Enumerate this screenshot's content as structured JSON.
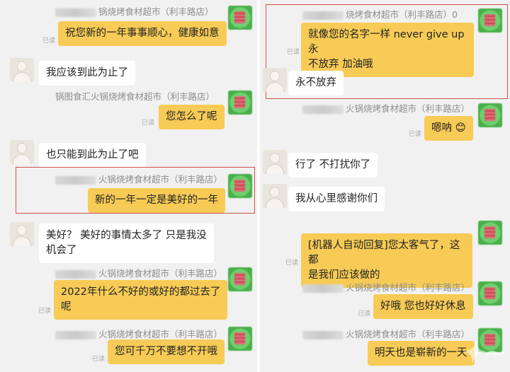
{
  "store_name_partial": {
    "l_n1": "锅烧烤食材超市（利丰路店）",
    "l_n2": "锅图食汇火锅烧烤食材超市（利丰路店）",
    "l_n3": "火锅烧烤食材超市（利丰路店）",
    "l_n4": "火锅烧烤食材超市（利丰路店）",
    "l_n5": "火锅烧烤食材超市（利丰路店）",
    "r_n1": "烧烤食材超市（利丰路店）0",
    "r_n2": "火锅烧烤食材超市（利丰路店）",
    "r_n3": "火锅烧烤食材超市（利丰路店）",
    "r_n4": "火锅烧烤食材超市（利丰路店）",
    "r_n5": "火锅烧烤食材超市（利丰路店）"
  },
  "read_label": "已读",
  "left": {
    "m1": "祝您新的一年事事顺心，健康如意",
    "m2": "我应该到此为止了",
    "m3": "您怎么了呢",
    "m4": "也只能到此为止了吧",
    "m5": "新的一年一定是美好的一年",
    "m6_l1": "美好？ 美好的事情太多了 只是我没",
    "m6_l2": "机会了",
    "m7_l1": "2022年什么不好的或好的都过去了",
    "m7_l2": "呢",
    "m8": "您可千万不要想不开哦"
  },
  "right": {
    "m1_l1": "就像您的名字一样 never give up 永",
    "m1_l2": "不放弃  加油哦",
    "m2": "永不放弃",
    "m3": "嗯呐 😊",
    "m4": "行了 不打扰你了",
    "m5": "我从心里感谢你们",
    "m6_l1": "[机器人自动回复]您太客气了，这都",
    "m6_l2": "是我们应该做的",
    "m7": "好哦  您也好好休息",
    "m8": "明天也是崭新的一天"
  },
  "colors": {
    "bubble_outgoing": "#f7cb56",
    "bubble_incoming": "#ffffff",
    "highlight_box": "#d0524a",
    "background": "#f1f1f1"
  }
}
